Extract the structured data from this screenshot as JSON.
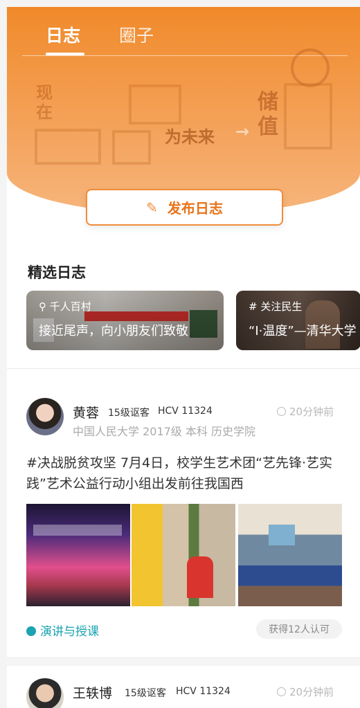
{
  "tabs": {
    "log": "日志",
    "circle": "圈子"
  },
  "hero": {
    "deco_now": "现在",
    "deco_store": "储值",
    "deco_future": "为未来",
    "deco_arrow": "→"
  },
  "publish": {
    "label": "发布日志",
    "icon": "feather-icon"
  },
  "featured": {
    "title": "精选日志",
    "items": [
      {
        "tag": "千人百村",
        "caption": "接近尾声，向小朋友们致敬"
      },
      {
        "tag": "# 关注民生",
        "caption": "“I·温度”—清华大学"
      }
    ]
  },
  "posts": [
    {
      "name": "黄蓉",
      "level": "15级讴客",
      "hcv": "HCV 11324",
      "time": "20分钟前",
      "school": "中国人民大学  2017级  本科  历史学院",
      "text": "#决战脱贫攻坚   7月4日，校学生艺术团“艺先锋·艺实践”艺术公益行动小组出发前往我国西",
      "topic": "演讲与授课",
      "approval": "获得12人认可"
    },
    {
      "name": "王轶博",
      "level": "15级讴客",
      "hcv": "HCV 11324",
      "time": "20分钟前"
    }
  ],
  "colors": {
    "accent": "#f08c3a",
    "topic": "#1aa3b0"
  }
}
